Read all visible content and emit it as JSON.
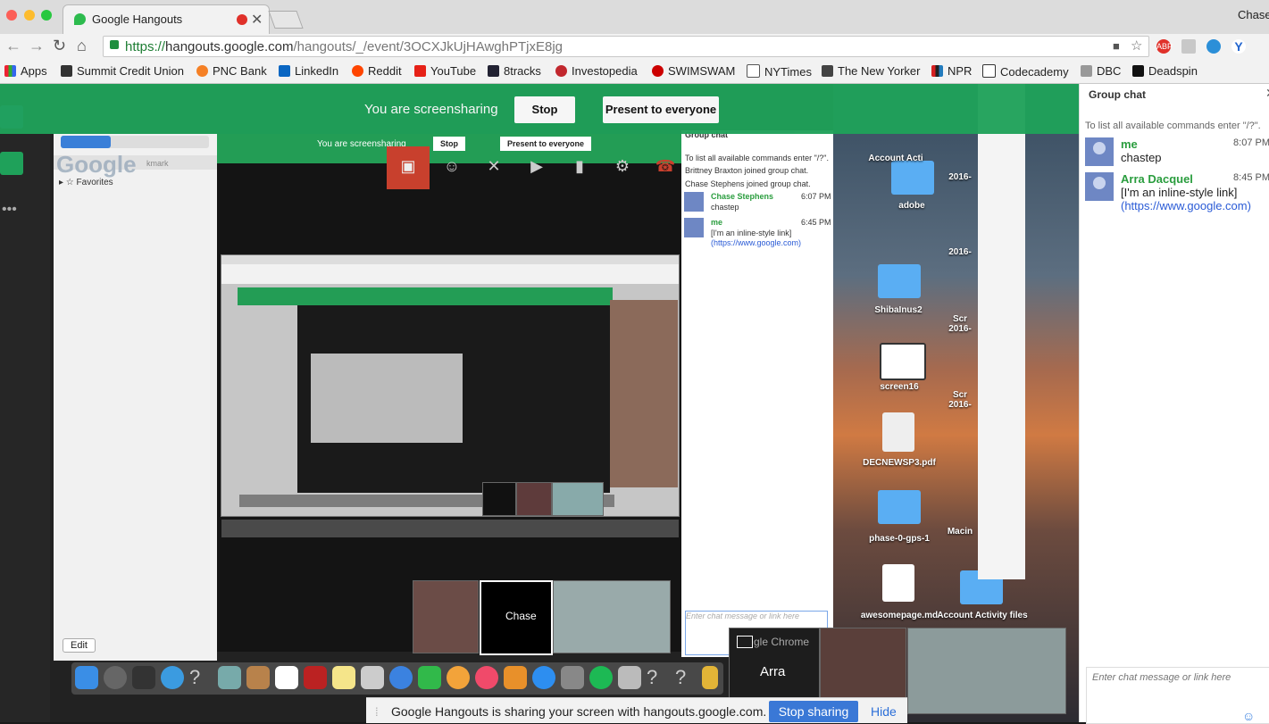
{
  "window": {
    "user": "Chase"
  },
  "tab": {
    "title": "Google Hangouts"
  },
  "address": {
    "scheme": "https://",
    "host": "hangouts.google.com",
    "path": "/hangouts/_/event/3OCXJkUjHAwghPTjxE8jg"
  },
  "bookmarks": [
    "Apps",
    "Summit Credit Union",
    "PNC Bank",
    "LinkedIn",
    "Reddit",
    "YouTube",
    "8tracks",
    "Investopedia",
    "SWIMSWAM",
    "NYTimes",
    "The New Yorker",
    "NPR",
    "Codecademy",
    "DBC",
    "Deadspin"
  ],
  "sharebar": {
    "message": "You are screensharing",
    "stop": "Stop",
    "present": "Present to everyone"
  },
  "nested": {
    "message": "You are screensharing",
    "stop": "Stop",
    "present": "Present to everyone",
    "finder_sidebar": "Favorites",
    "finder_edit": "Edit",
    "google_logo": "Google",
    "bookmark_field": "kmark",
    "chat_title": "Group chat",
    "chat_lines": [
      "To list all available commands enter \"/?\".",
      "Brittney Braxton joined group chat.",
      "Chase Stephens joined group chat."
    ],
    "chat_msg1_name": "Chase Stephens",
    "chat_msg1_time": "6:07 PM",
    "chat_msg1_body": "chastep",
    "chat_msg2_name": "me",
    "chat_msg2_time": "6:45 PM",
    "chat_msg2_body": "[I'm an inline-style link]",
    "chat_msg2_link": "(https://www.google.com)",
    "chat_placeholder": "Enter chat message or link here",
    "thumb_chase": "Chase",
    "thumb_arra": "Arra",
    "chrome_label": "gle Chrome"
  },
  "desktop_icons": [
    "Account Acti",
    "adobe",
    "ShibaInus2",
    "screen16",
    "DECNEWSP3.pdf",
    "phase-0-gps-1",
    "awesomepage.md",
    "Account Activity files",
    "2016-",
    "2016-",
    "Scr 2016-",
    "Scr 2016-",
    "Macin"
  ],
  "notice": {
    "text": "Google Hangouts is sharing your screen with hangouts.google.com.",
    "stop": "Stop sharing",
    "hide": "Hide"
  },
  "chat": {
    "title": "Group chat",
    "command_hint": "To list all available commands enter \"/?\".",
    "messages": [
      {
        "name": "me",
        "time": "8:07 PM",
        "body": "chastep",
        "link": ""
      },
      {
        "name": "Arra Dacquel",
        "time": "8:45 PM",
        "body": "[I'm an inline-style link]",
        "link": "(https://www.google.com)"
      }
    ],
    "input_placeholder": "Enter chat message or link here"
  }
}
